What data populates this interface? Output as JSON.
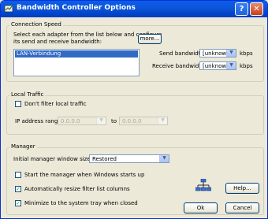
{
  "window": {
    "title": "Bandwidth Controller Options"
  },
  "connection_speed": {
    "legend": "Connection Speed",
    "instructions_line1": "Select each adapter from the list below and configure",
    "instructions_line2": "its send and receive bandwidth:",
    "more_button": "more...",
    "adapters": [
      "LAN-Verbindung"
    ],
    "send_label": "Send bandwidth:",
    "send_value": "[unknown]",
    "send_unit": "kbps",
    "receive_label": "Receive bandwidth:",
    "receive_value": "[unknown]",
    "receive_unit": "kbps"
  },
  "local_traffic": {
    "legend": "Local Traffic",
    "dont_filter_label": "Don't filter local traffic",
    "dont_filter_checked": false,
    "ip_label": "IP address range:",
    "ip_from": "0.0.0.0",
    "to_label": "to",
    "ip_to": "0.0.0.0"
  },
  "manager": {
    "legend": "Manager",
    "window_size_label": "Initial manager window size:",
    "window_size_value": "Restored",
    "start_label": "Start the manager when Windows starts up",
    "start_checked": false,
    "resize_label": "Automatically resize filter list columns",
    "resize_checked": true,
    "minimize_label": "Minimize to the system tray when closed",
    "minimize_checked": true
  },
  "buttons": {
    "help": "Help...",
    "ok": "Ok",
    "cancel": "Cancel"
  },
  "icons": {
    "network": "network-icon"
  }
}
